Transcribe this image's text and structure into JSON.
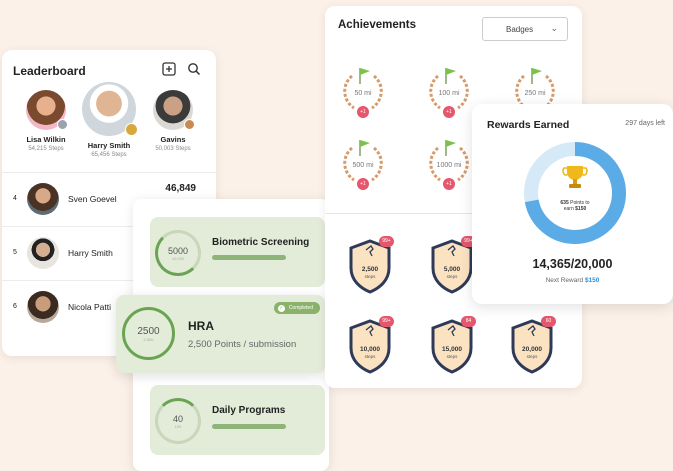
{
  "leaderboard": {
    "title": "Leaderboard",
    "top3": [
      {
        "name": "Lisa Wilkin",
        "steps": "54,215 Steps",
        "badge_color": "#9aa3ad"
      },
      {
        "name": "Harry Smith",
        "steps": "65,456 Steps",
        "badge_color": "#d8a83c"
      },
      {
        "name": "Gavins",
        "steps": "50,003 Steps",
        "badge_color": "#c98a52"
      }
    ],
    "rows": [
      {
        "rank": "4",
        "name": "Sven Goevel",
        "value": "46,849"
      },
      {
        "rank": "5",
        "name": "Harry Smith",
        "value": ""
      },
      {
        "rank": "6",
        "name": "Nicola Patti",
        "value": ""
      }
    ]
  },
  "programs": {
    "biometric": {
      "title": "Biometric Screening",
      "value": "5000",
      "sub": "10,000"
    },
    "hra": {
      "title": "HRA",
      "subtitle": "2,500 Points / submission",
      "value": "2500",
      "sub": "2,500",
      "badge": "Completed"
    },
    "daily": {
      "title": "Daily Programs",
      "value": "40",
      "sub": "100"
    }
  },
  "achievements": {
    "title": "Achievements",
    "select_value": "Badges",
    "wreaths": [
      {
        "label": "50 mi",
        "badge": "+1"
      },
      {
        "label": "100 mi",
        "badge": "+1"
      },
      {
        "label": "250 mi",
        "badge": "+1"
      },
      {
        "label": "500 mi",
        "badge": "+1"
      },
      {
        "label": "1000 mi",
        "badge": "+1"
      }
    ],
    "shields": [
      {
        "value": "2,500",
        "unit": "steps",
        "badge": "99+"
      },
      {
        "value": "5,000",
        "unit": "steps",
        "badge": "99+"
      },
      {
        "value": "10,000",
        "unit": "steps",
        "badge": "99+"
      },
      {
        "value": "15,000",
        "unit": "steps",
        "badge": "84"
      },
      {
        "value": "20,000",
        "unit": "steps",
        "badge": "60"
      }
    ]
  },
  "rewards": {
    "title": "Rewards Earned",
    "days_left": "297 days left",
    "points_text": "635",
    "points_label": "Points to",
    "earn_label": "earn",
    "earn_amount": "$150",
    "progress_fraction": 0.72,
    "total": "14,365/20,000",
    "next_label": "Next Reward",
    "next_amount": "$150",
    "colors": {
      "ring": "#5aabe6",
      "track": "#d6e9f7",
      "trophy": "#f0b81a"
    }
  }
}
